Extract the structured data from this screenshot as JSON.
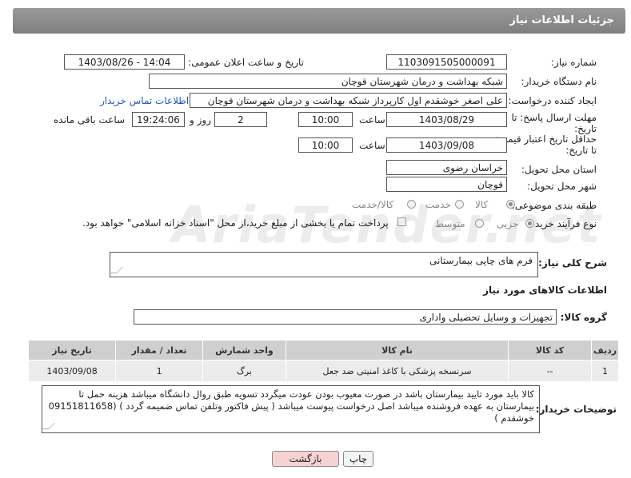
{
  "header": {
    "title": "جزئیات اطلاعات نیاز"
  },
  "fields": {
    "need_number_label": "شماره نیاز:",
    "need_number": "1103091505000091",
    "announce_label": "تاریخ و ساعت اعلان عمومی:",
    "announce_value": "1403/08/26 - 14:04",
    "buyer_org_label": "نام دستگاه خریدار:",
    "buyer_org": "شبکه بهداشت و درمان شهرستان قوچان",
    "creator_label": "ایجاد کننده درخواست:",
    "creator": "علی اصغر خوشقدم اول کارپرداز شبکه بهداشت و درمان شهرستان قوچان",
    "buyer_contact_link": "اطلاعات تماس خریدار",
    "deadline_label": "مهلت ارسال پاسخ: تا تاریخ:",
    "deadline_date": "1403/08/29",
    "time_label": "ساعت",
    "deadline_time": "10:00",
    "days_value": "2",
    "days_label": "روز و",
    "remaining_time": "19:24:06",
    "remaining_label": "ساعت باقی مانده",
    "price_valid_label": "حداقل تاریخ اعتبار قیمت: تا تاریخ:",
    "price_valid_date": "1403/09/08",
    "price_valid_time": "10:00",
    "province_label": "استان محل تحویل:",
    "province": "خراسان رضوی",
    "city_label": "شهر محل تحویل:",
    "city": "قوچان",
    "category_label": "طبقه بندی موضوعی:",
    "category_options": [
      "کالا",
      "خدمت",
      "کالا/خدمت"
    ],
    "process_label": "نوع فرآیند خرید :",
    "process_options": [
      "جزیی",
      "متوسط"
    ],
    "payment_note": "پرداخت تمام یا بخشی از مبلغ خرید،از محل \"اسناد خزانه اسلامی\" خواهد بود."
  },
  "summary": {
    "label": "شرح کلی نیاز:",
    "value": "فرم های چاپی بیمارستانی"
  },
  "goods_section": {
    "title": "اطلاعات کالاهای مورد نیاز",
    "group_label": "گروه کالا:",
    "group_value": "تجهیزات و وسایل تحصیلی واداری"
  },
  "table": {
    "headers": [
      "ردیف",
      "کد کالا",
      "نام کالا",
      "واحد شمارش",
      "تعداد / مقدار",
      "تاریخ نیاز"
    ],
    "rows": [
      [
        "1",
        "--",
        "سرنسخه پزشکی با کاغذ امنیتی ضد جعل",
        "برگ",
        "1",
        "1403/09/08"
      ]
    ]
  },
  "notes": {
    "label": "توضیحات خریدار:",
    "value": "کالا باید مورد تایید بیمارستان باشد در صورت معیوب بودن عودت میگردد تسویه طبق روال دانشگاه میباشد هزینه حمل تا بیمارستان به عهده فروشنده میباشد اصل درخواست پیوست میباشد ( پیش فاکتور وتلفن تماس ضمیمه گردد ) (09151811658 خوشقدم )"
  },
  "buttons": {
    "print": "چاپ",
    "back": "بازگشت"
  },
  "colors": {
    "header_bg": "#8c8c8c",
    "back_button_bg": "#f6d3d3",
    "link": "#1f56c2"
  }
}
